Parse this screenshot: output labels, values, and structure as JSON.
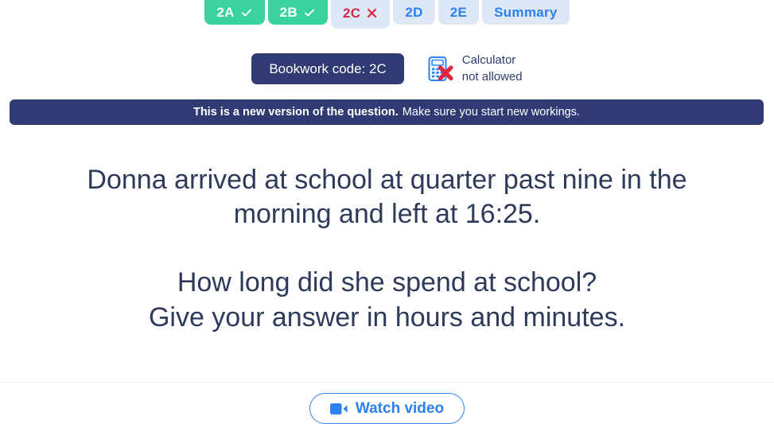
{
  "colors": {
    "navy": "#2f3b72",
    "green": "#3ad29f",
    "blue": "#2c80ef",
    "red": "#d6264c",
    "tab_inactive_bg": "#dde7f5",
    "question_text": "#2e3a59"
  },
  "tabs": [
    {
      "label": "2A",
      "state": "done",
      "mark": "check-icon"
    },
    {
      "label": "2B",
      "state": "done",
      "mark": "check-icon"
    },
    {
      "label": "2C",
      "state": "active",
      "mark": "cross-icon"
    },
    {
      "label": "2D",
      "state": "pending",
      "mark": ""
    },
    {
      "label": "2E",
      "state": "pending",
      "mark": ""
    },
    {
      "label": "Summary",
      "state": "pending",
      "mark": ""
    }
  ],
  "meta": {
    "bookwork_label": "Bookwork code: 2C",
    "calculator_line1": "Calculator",
    "calculator_line2": "not allowed"
  },
  "notice": {
    "lead": "This is a new version of the question.",
    "rest": "Make sure you start new workings."
  },
  "question": {
    "line1": "Donna arrived at school at quarter past nine in the",
    "line2": "morning and left at 16:25.",
    "line3": "How long did she spend at school?",
    "line4": "Give your answer in hours and minutes."
  },
  "footer": {
    "watch_video_label": "Watch video"
  }
}
